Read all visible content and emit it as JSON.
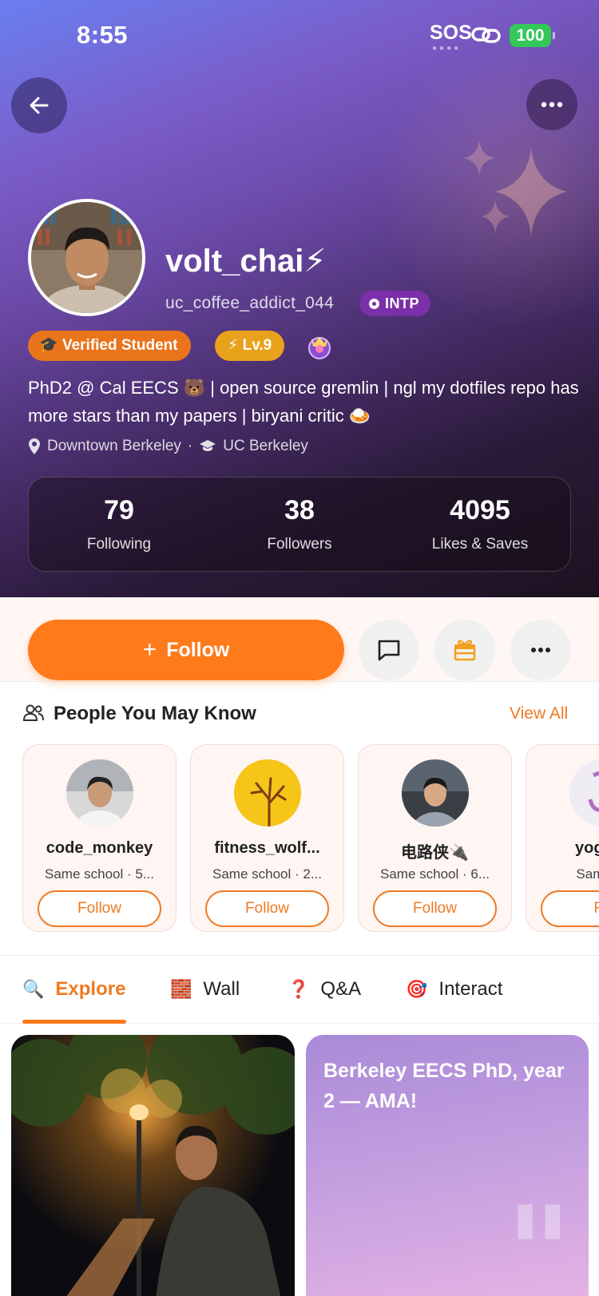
{
  "status_bar": {
    "time": "8:55",
    "sos": "SOS",
    "battery": "100"
  },
  "profile": {
    "username": "volt_chai⚡",
    "handle": "uc_coffee_addict_044",
    "mbti": "INTP",
    "badges": {
      "verified": "Verified Student",
      "level": "Lv.9"
    },
    "bio": "PhD2 @ Cal EECS 🐻 | open source gremlin | ngl my dotfiles repo has more stars than my papers | biryani critic 🍛",
    "location": "Downtown Berkeley",
    "separator": "·",
    "school": "UC Berkeley",
    "stats": [
      {
        "value": "79",
        "label": "Following"
      },
      {
        "value": "38",
        "label": "Followers"
      },
      {
        "value": "4095",
        "label": "Likes & Saves"
      }
    ]
  },
  "actions": {
    "follow_label": "Follow",
    "follow_prefix": "+"
  },
  "pymk": {
    "title": "People You May Know",
    "view_all": "View All",
    "cards": [
      {
        "name": "code_monkey",
        "sub": "Same school · 5...",
        "button": "Follow"
      },
      {
        "name": "fitness_wolf...",
        "sub": "Same school · 2...",
        "button": "Follow"
      },
      {
        "name": "电路侠🔌",
        "sub": "Same school · 6...",
        "button": "Follow"
      },
      {
        "name": "yoga_s",
        "sub": "Same sc",
        "button": "Fo"
      }
    ]
  },
  "tabs": [
    {
      "label": "Explore",
      "icon": "🔍"
    },
    {
      "label": "Wall",
      "icon": "🧱"
    },
    {
      "label": "Q&A",
      "icon": "❓"
    },
    {
      "label": "Interact",
      "icon": "🎯"
    }
  ],
  "feed": {
    "text_post_title": "Berkeley EECS PhD, year 2 — AMA!"
  },
  "colors": {
    "accent": "#ff7a1a",
    "mbti": "#7b2fa8",
    "verified": "#e9741c",
    "level": "#e9a21c"
  }
}
